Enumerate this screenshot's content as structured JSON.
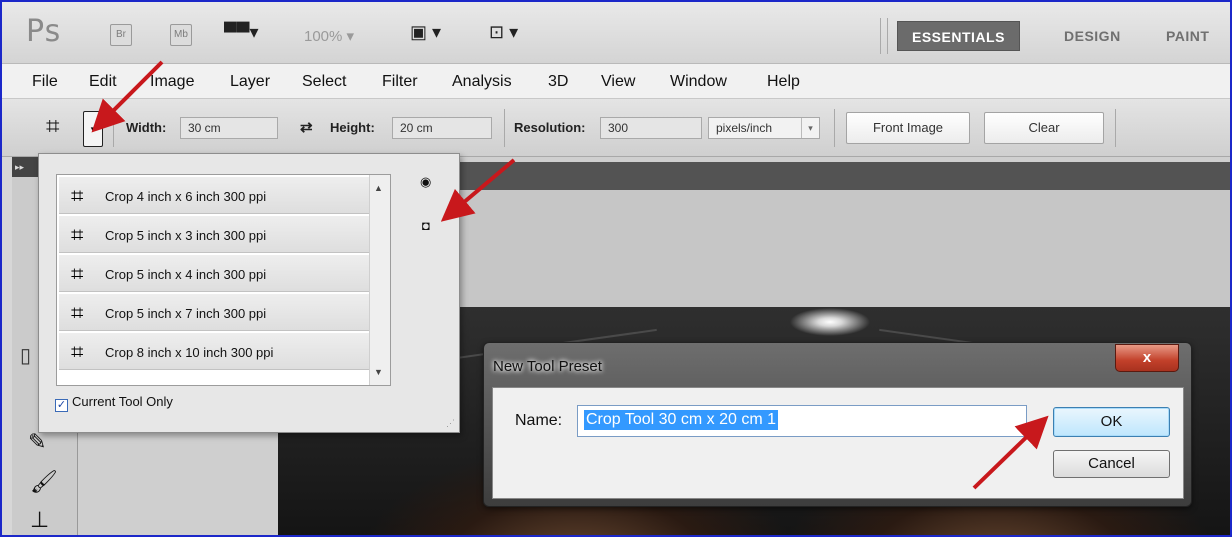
{
  "appbar": {
    "logo": "Ps",
    "bridge_label": "Br",
    "mini_bridge_label": "Mb",
    "zoom": "100%",
    "workspaces": [
      "ESSENTIALS",
      "DESIGN",
      "PAINT"
    ]
  },
  "menu": [
    "File",
    "Edit",
    "Image",
    "Layer",
    "Select",
    "Filter",
    "Analysis",
    "3D",
    "View",
    "Window",
    "Help"
  ],
  "options": {
    "width_label": "Width:",
    "width_value": "30 cm",
    "height_label": "Height:",
    "height_value": "20 cm",
    "resolution_label": "Resolution:",
    "resolution_value": "300",
    "resolution_unit": "pixels/inch",
    "front_image_label": "Front Image",
    "clear_label": "Clear"
  },
  "preset_panel": {
    "presets": [
      "Crop 4 inch x 6 inch 300 ppi",
      "Crop 5 inch x 3 inch 300 ppi",
      "Crop 5 inch x 4 inch 300 ppi",
      "Crop 5 inch x 7 inch 300 ppi",
      "Crop 8 inch x 10 inch 300 ppi"
    ],
    "current_tool_only_label": "Current Tool Only",
    "current_tool_only_checked": true
  },
  "dialog": {
    "title": "New Tool Preset",
    "close_label": "x",
    "name_label": "Name:",
    "name_value": "Crop Tool 30 cm x 20 cm 1",
    "ok_label": "OK",
    "cancel_label": "Cancel"
  },
  "colors": {
    "frame_border": "#1b27c9",
    "annotation_arrow": "#c8181c",
    "selection": "#3399ff"
  },
  "icons": {
    "crop": "crop-icon",
    "swap": "swap-arrows-icon",
    "flyout": "panel-menu-icon",
    "new_preset": "new-preset-icon"
  }
}
